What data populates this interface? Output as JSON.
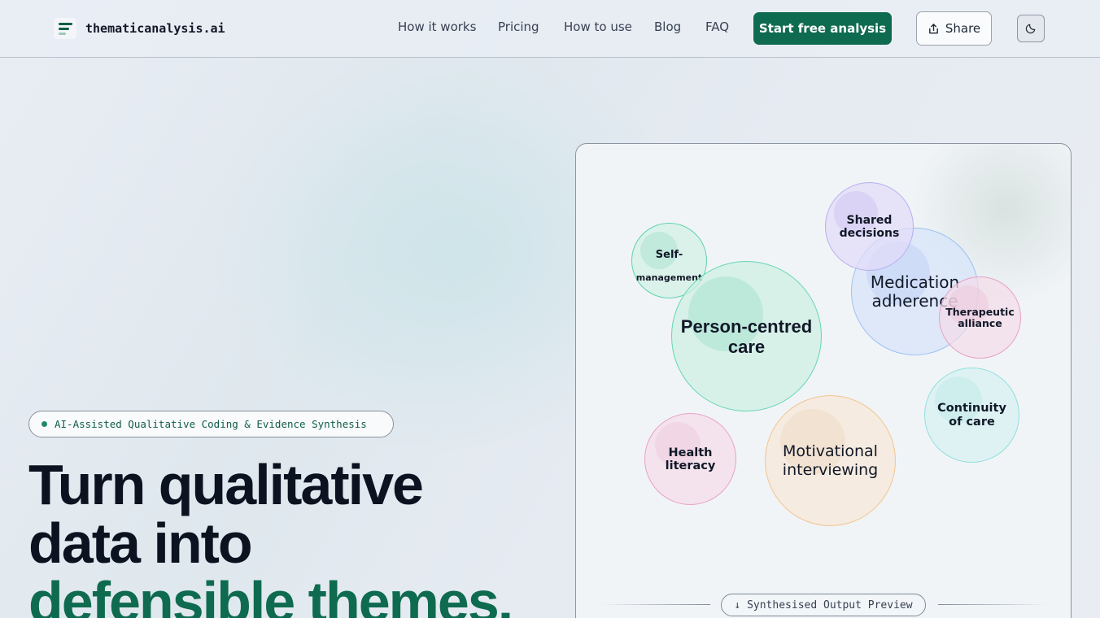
{
  "header": {
    "brand": "thematicanalysis.ai",
    "nav": [
      "How it works",
      "Pricing",
      "How to use",
      "Blog",
      "FAQ"
    ],
    "cta_label": "Start free analysis",
    "share_label": "Share",
    "icons": {
      "logo": "bars-logo-icon",
      "share": "share-icon",
      "theme": "moon-icon"
    }
  },
  "hero": {
    "badge": "AI-Assisted Qualitative Coding & Evidence Synthesis",
    "title_line1": "Turn qualitative",
    "title_line2": "data into",
    "title_line3": "defensible themes."
  },
  "preview": {
    "caption": "↓ Synthesised Output Preview",
    "themes": [
      {
        "label": "Self-",
        "sub": "management",
        "color": "teal"
      },
      {
        "label": "Person-centred\ncare",
        "color": "mint"
      },
      {
        "label": "Shared\ndecisions",
        "color": "lavender"
      },
      {
        "label": "Medication\nadherence",
        "color": "blue"
      },
      {
        "label": "Therapeutic\nalliance",
        "color": "pink"
      },
      {
        "label": "Continuity\nof care",
        "color": "cyan"
      },
      {
        "label": "Health\nliteracy",
        "color": "pink"
      },
      {
        "label": "Motivational\ninterviewing",
        "color": "peach"
      }
    ]
  },
  "colors": {
    "primary": "#0f6b4f",
    "accent_text": "#0f6b4f",
    "ink": "#0b1220"
  }
}
